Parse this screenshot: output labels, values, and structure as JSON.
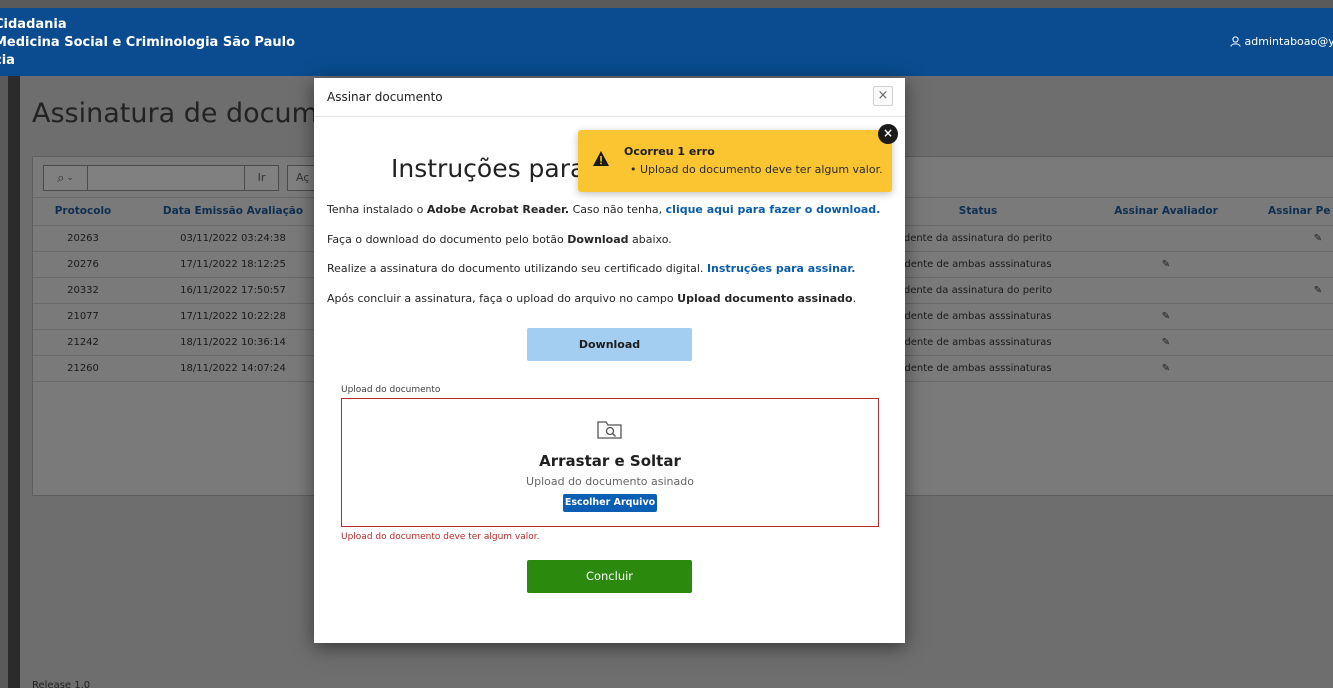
{
  "header": {
    "line1": "Cidadania",
    "line2": "Medicina Social e Criminologia São Paulo",
    "line3": "cia",
    "user": "admintaboao@yopr"
  },
  "page": {
    "title": "Assinatura de documen",
    "footer": "Release 1.0"
  },
  "report": {
    "go_label": "Ir",
    "actions_label": "Aç",
    "columns": [
      "Protocolo",
      "Data Emissão Avaliação",
      "Status",
      "Assinar Avaliador",
      "Assinar Pe"
    ],
    "rows": [
      {
        "protocolo": "20263",
        "data": "03/11/2022 03:24:38",
        "status": "dente da assinatura do perito",
        "avaliador": "",
        "perito": "✎"
      },
      {
        "protocolo": "20276",
        "data": "17/11/2022 18:12:25",
        "status": "dente de ambas asssinaturas",
        "avaliador": "✎",
        "perito": ""
      },
      {
        "protocolo": "20332",
        "data": "16/11/2022 17:50:57",
        "status": "dente da assinatura do perito",
        "avaliador": "",
        "perito": "✎"
      },
      {
        "protocolo": "21077",
        "data": "17/11/2022 10:22:28",
        "status": "dente de ambas asssinaturas",
        "avaliador": "✎",
        "perito": ""
      },
      {
        "protocolo": "21242",
        "data": "18/11/2022 10:36:14",
        "status": "dente de ambas asssinaturas",
        "avaliador": "✎",
        "perito": ""
      },
      {
        "protocolo": "21260",
        "data": "18/11/2022 14:07:24",
        "status": "dente de ambas asssinaturas",
        "avaliador": "✎",
        "perito": ""
      }
    ]
  },
  "modal": {
    "title": "Assinar documento",
    "close_icon": "×",
    "instructions_title": "Instruções para",
    "line1_a": "Tenha instalado o ",
    "line1_b": "Adobe Acrobat Reader.",
    "line1_c": " Caso não tenha, ",
    "line1_link": "clique aqui para fazer o download.",
    "line2_a": "Faça o download do documento pelo botão ",
    "line2_b": "Download",
    "line2_c": " abaixo.",
    "line3_a": "Realize a assinatura do documento utilizando seu certificado digital. ",
    "line3_link": "Instruções para assinar.",
    "line4_a": "Após concluir a assinatura, faça o upload do arquivo no campo ",
    "line4_b": "Upload documento assinado",
    "line4_c": ".",
    "download_label": "Download",
    "upload_label": "Upload do documento",
    "drop_title": "Arrastar e Soltar",
    "drop_subtitle": "Upload do documento asinado",
    "choose_file_label": "Escolher Arquivo",
    "field_error": "Upload do documento deve ter algum valor.",
    "concluir_label": "Concluir"
  },
  "notification": {
    "title": "Ocorreu 1 erro",
    "message": "• Upload do documento deve ter algum valor.",
    "close_icon": "×",
    "color": "#fbc531"
  },
  "colors": {
    "header": "#0a4c8f",
    "link": "#0b5cad",
    "download_button": "#a4cdf2",
    "concluir_button": "#2b8a0e",
    "error": "#c02a2a"
  }
}
